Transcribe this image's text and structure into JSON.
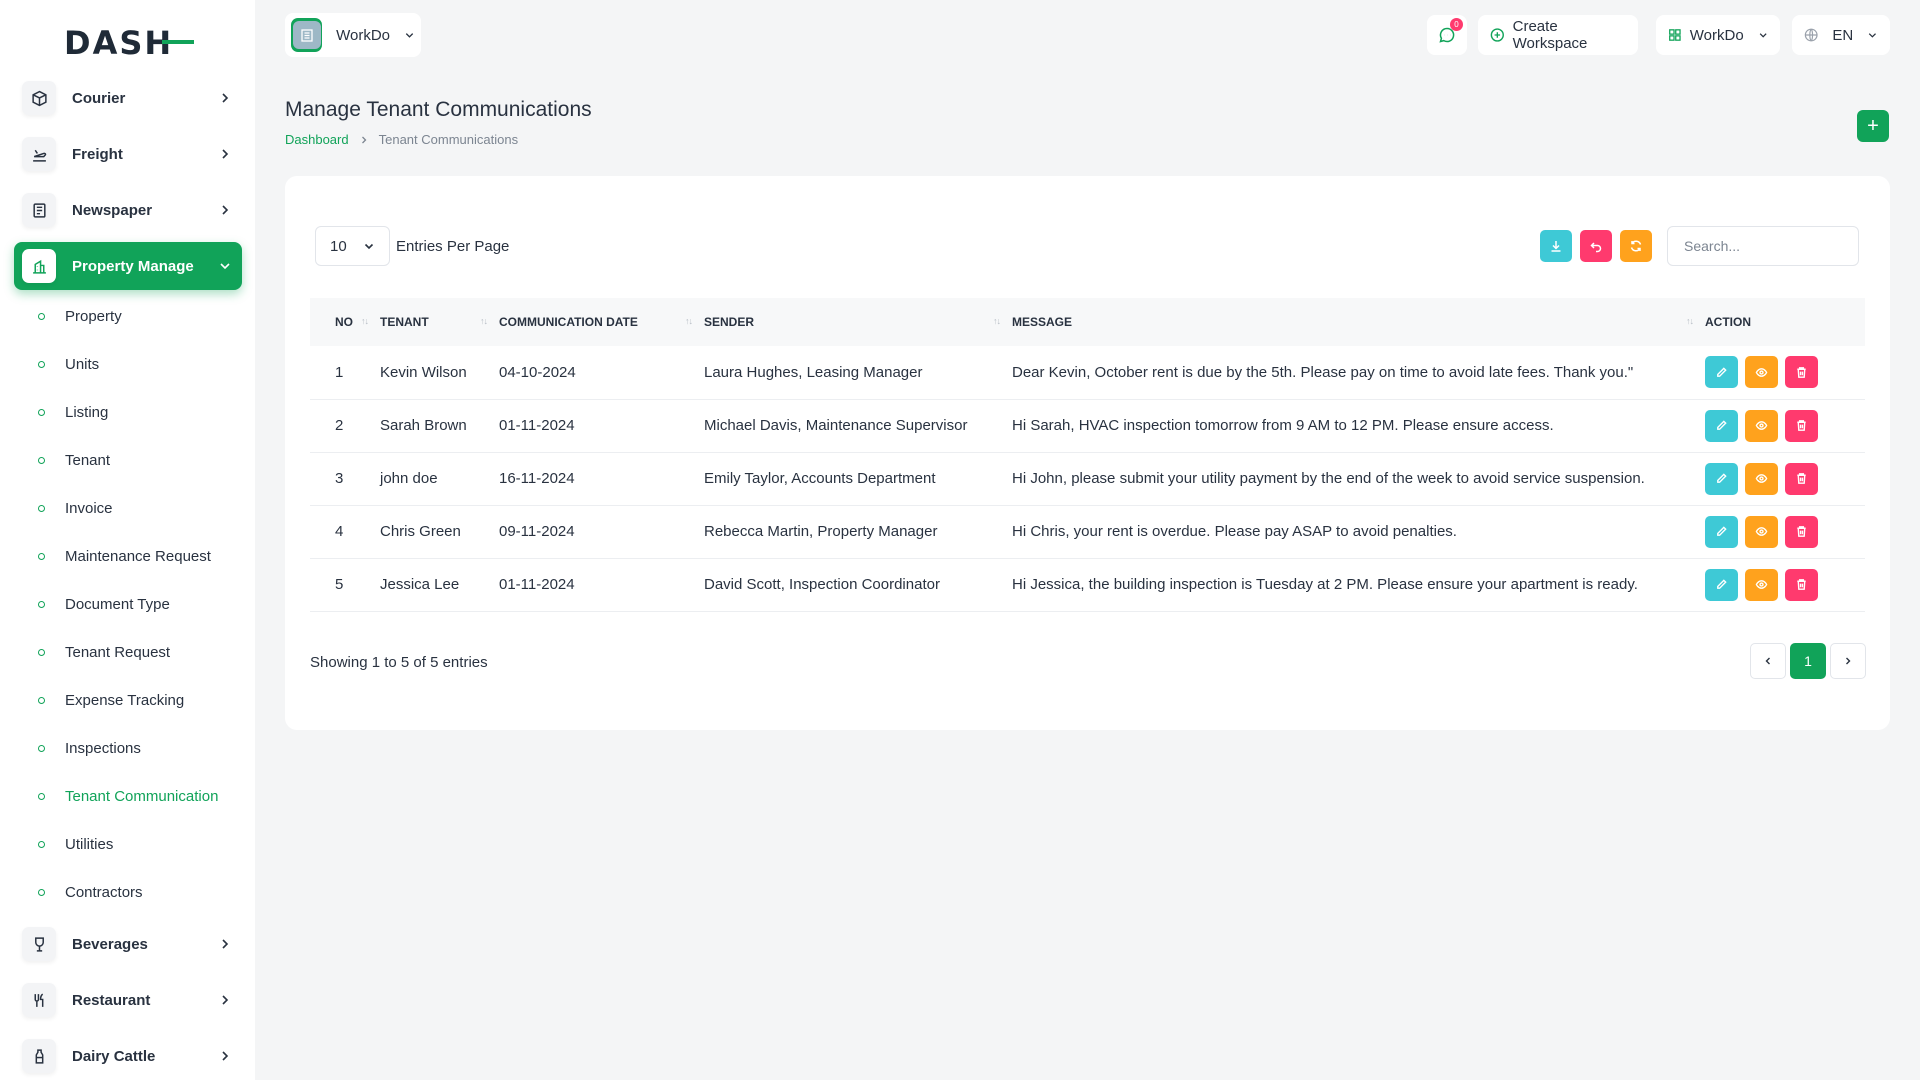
{
  "brand": {
    "logo_text": "DASH"
  },
  "sidebar": {
    "top_items": [
      {
        "label": "Courier",
        "icon": "box-icon"
      },
      {
        "label": "Freight",
        "icon": "plane-icon"
      },
      {
        "label": "Newspaper",
        "icon": "newspaper-icon"
      },
      {
        "label": "Property Manage",
        "icon": "building-icon",
        "active": true
      }
    ],
    "sub_items": [
      {
        "label": "Property"
      },
      {
        "label": "Units"
      },
      {
        "label": "Listing"
      },
      {
        "label": "Tenant"
      },
      {
        "label": "Invoice"
      },
      {
        "label": "Maintenance Request"
      },
      {
        "label": "Document Type"
      },
      {
        "label": "Tenant Request"
      },
      {
        "label": "Expense Tracking"
      },
      {
        "label": "Inspections"
      },
      {
        "label": "Tenant Communication",
        "current": true
      },
      {
        "label": "Utilities"
      },
      {
        "label": "Contractors"
      }
    ],
    "bottom_items": [
      {
        "label": "Beverages",
        "icon": "glass-icon"
      },
      {
        "label": "Restaurant",
        "icon": "utensils-icon"
      },
      {
        "label": "Dairy Cattle",
        "icon": "bottle-icon"
      }
    ]
  },
  "header": {
    "workspace": "WorkDo",
    "chat_badge": "0",
    "create_workspace": "Create Workspace",
    "workdo_menu": "WorkDo",
    "language": "EN"
  },
  "page": {
    "title": "Manage Tenant Communications",
    "breadcrumb": {
      "home": "Dashboard",
      "current": "Tenant Communications"
    },
    "add_label": "+"
  },
  "table_controls": {
    "entries_value": "10",
    "entries_label": "Entries Per Page",
    "search_placeholder": "Search..."
  },
  "table": {
    "columns": [
      "NO",
      "TENANT",
      "COMMUNICATION DATE",
      "SENDER",
      "MESSAGE",
      "ACTION"
    ],
    "rows": [
      {
        "no": "1",
        "tenant": "Kevin Wilson",
        "date": "04-10-2024",
        "sender": "Laura Hughes, Leasing Manager",
        "message": "Dear Kevin, October rent is due by the 5th. Please pay on time to avoid late fees. Thank you.\""
      },
      {
        "no": "2",
        "tenant": "Sarah Brown",
        "date": "01-11-2024",
        "sender": "Michael Davis, Maintenance Supervisor",
        "message": "Hi Sarah, HVAC inspection tomorrow from 9 AM to 12 PM. Please ensure access."
      },
      {
        "no": "3",
        "tenant": "john doe",
        "date": "16-11-2024",
        "sender": "Emily Taylor, Accounts Department",
        "message": "Hi John, please submit your utility payment by the end of the week to avoid service suspension."
      },
      {
        "no": "4",
        "tenant": "Chris Green",
        "date": "09-11-2024",
        "sender": "Rebecca Martin, Property Manager",
        "message": "Hi Chris, your rent is overdue. Please pay ASAP to avoid penalties."
      },
      {
        "no": "5",
        "tenant": "Jessica Lee",
        "date": "01-11-2024",
        "sender": "David Scott, Inspection Coordinator",
        "message": "Hi Jessica, the building inspection is Tuesday at 2 PM. Please ensure your apartment is ready."
      }
    ]
  },
  "footer": {
    "showing": "Showing 1 to 5 of 5 entries",
    "current_page": "1"
  },
  "colors": {
    "accent": "#11a359",
    "cyan": "#3ec9d6",
    "orange": "#ffa21d",
    "pink": "#ff3a6e"
  }
}
